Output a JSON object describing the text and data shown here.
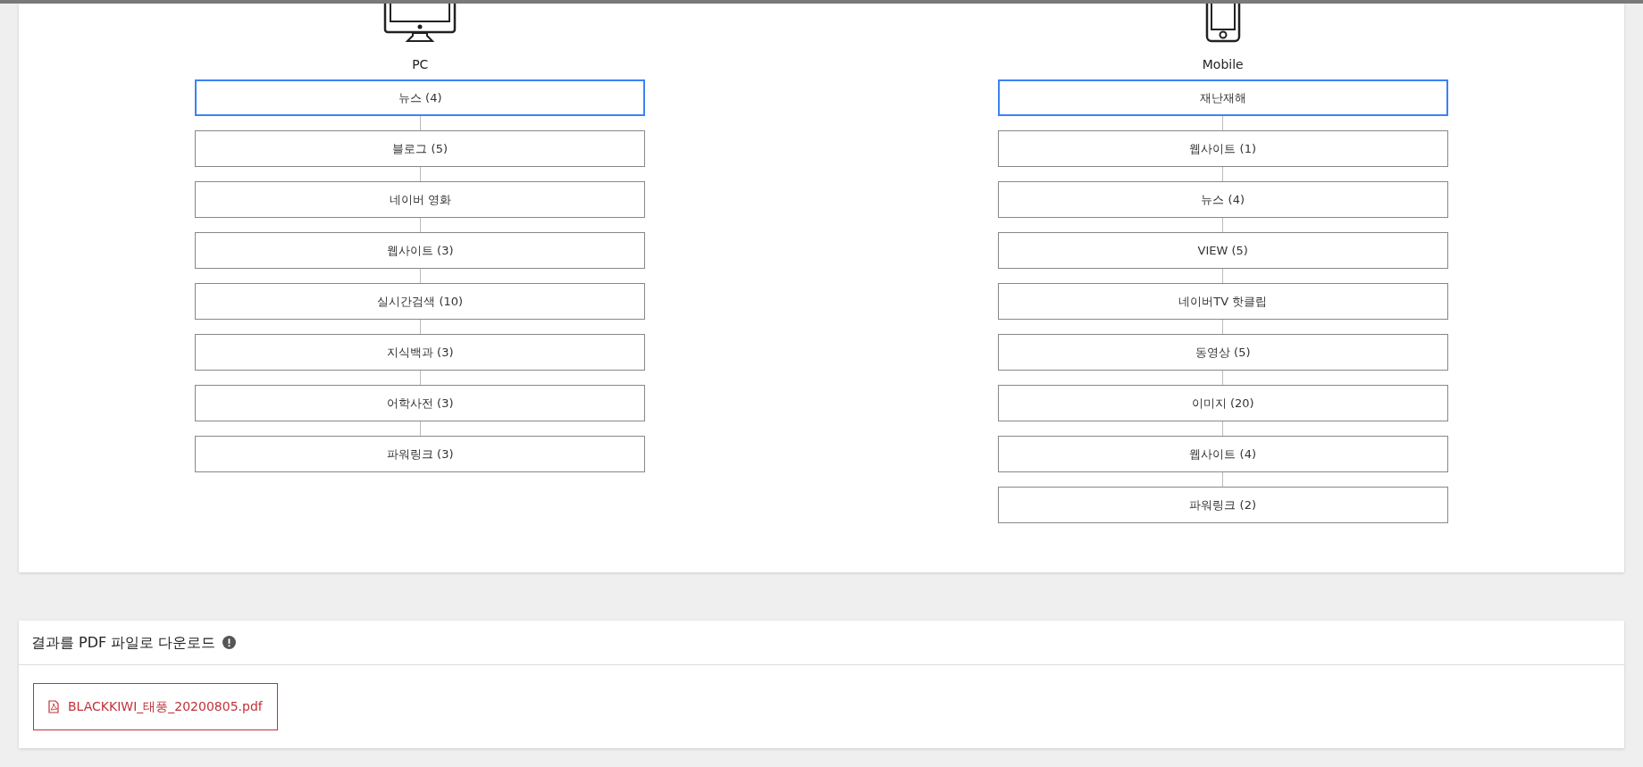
{
  "devices": [
    {
      "kind": "pc",
      "label": "PC",
      "items": [
        {
          "label": "뉴스 (4)",
          "selected": true
        },
        {
          "label": "블로그 (5)",
          "selected": false
        },
        {
          "label": "네이버 영화",
          "selected": false
        },
        {
          "label": "웹사이트 (3)",
          "selected": false
        },
        {
          "label": "실시간검색 (10)",
          "selected": false
        },
        {
          "label": "지식백과 (3)",
          "selected": false
        },
        {
          "label": "어학사전 (3)",
          "selected": false
        },
        {
          "label": "파워링크 (3)",
          "selected": false
        }
      ]
    },
    {
      "kind": "mobile",
      "label": "Mobile",
      "items": [
        {
          "label": "재난재해",
          "selected": true
        },
        {
          "label": "웹사이트 (1)",
          "selected": false
        },
        {
          "label": "뉴스 (4)",
          "selected": false
        },
        {
          "label": "VIEW (5)",
          "selected": false
        },
        {
          "label": "네이버TV 핫클립",
          "selected": false
        },
        {
          "label": "동영상 (5)",
          "selected": false
        },
        {
          "label": "이미지 (20)",
          "selected": false
        },
        {
          "label": "웹사이트 (4)",
          "selected": false
        },
        {
          "label": "파워링크 (2)",
          "selected": false
        }
      ]
    }
  ],
  "download": {
    "title": "결과를 PDF 파일로 다운로드",
    "file": "BLACKKIWI_태풍_20200805.pdf"
  }
}
